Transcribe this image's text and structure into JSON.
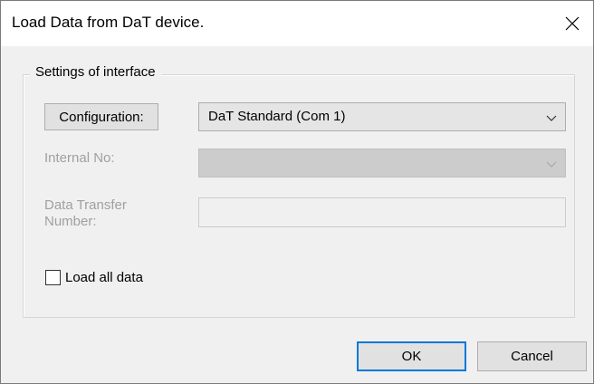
{
  "window": {
    "title": "Load Data from DaT device.",
    "close_icon": "close-icon"
  },
  "group": {
    "legend": "Settings of interface",
    "configuration": {
      "button_label": "Configuration:",
      "selected_value": "DaT Standard (Com 1)",
      "arrow_icon": "chevron-down-icon"
    },
    "internal_no": {
      "label": "Internal No:",
      "selected_value": "",
      "enabled": false
    },
    "data_transfer": {
      "label": "Data Transfer Number:",
      "value": "",
      "enabled": false
    },
    "load_all": {
      "label": "Load all data",
      "checked": false
    }
  },
  "buttons": {
    "ok_label": "OK",
    "cancel_label": "Cancel"
  },
  "colors": {
    "default_button_border": "#0078d7",
    "disabled_text": "#a0a0a0"
  }
}
